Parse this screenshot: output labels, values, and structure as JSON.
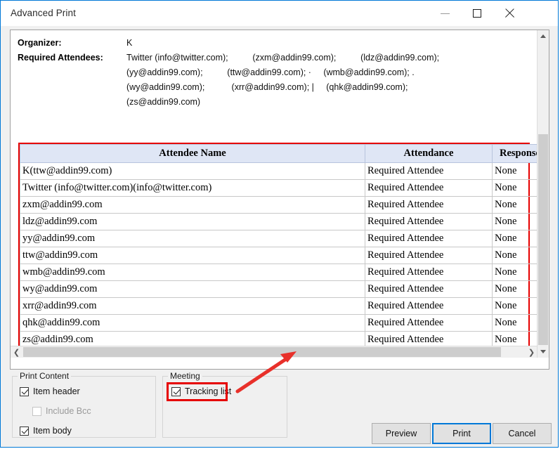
{
  "window": {
    "title": "Advanced Print",
    "controls": {
      "minimize": "minimize-icon",
      "maximize": "maximize-icon",
      "close": "close-icon"
    }
  },
  "preview": {
    "organizer_label": "Organizer:",
    "organizer_value": "K",
    "required_label": "Required Attendees:",
    "attendee_lines": [
      "Twitter (info@twitter.com);          (zxm@addin99.com);          (ldz@addin99.com);",
      "(yy@addin99.com);          (ttw@addin99.com); ·     (wmb@addin99.com); .",
      "(wy@addin99.com);           (xrr@addin99.com); |     (qhk@addin99.com);",
      "(zs@addin99.com)"
    ],
    "table": {
      "columns": [
        "Attendee Name",
        "Attendance",
        "Response"
      ],
      "rows": [
        [
          "K(ttw@addin99.com)",
          "Required Attendee",
          "None"
        ],
        [
          "Twitter (info@twitter.com)(info@twitter.com)",
          "Required Attendee",
          "None"
        ],
        [
          "zxm@addin99.com",
          "Required Attendee",
          "None"
        ],
        [
          "ldz@addin99.com",
          "Required Attendee",
          "None"
        ],
        [
          "yy@addin99.com",
          "Required Attendee",
          "None"
        ],
        [
          "ttw@addin99.com",
          "Required Attendee",
          "None"
        ],
        [
          "wmb@addin99.com",
          "Required Attendee",
          "None"
        ],
        [
          " wy@addin99.com",
          "Required Attendee",
          "None"
        ],
        [
          "xrr@addin99.com",
          "Required Attendee",
          "None"
        ],
        [
          "qhk@addin99.com",
          "Required Attendee",
          "None"
        ],
        [
          "zs@addin99.com",
          "Required Attendee",
          "None"
        ]
      ]
    }
  },
  "print_content": {
    "group_title": "Print Content",
    "item_header": {
      "label": "Item header",
      "checked": true,
      "enabled": true
    },
    "include_bcc": {
      "label": "Include Bcc",
      "checked": false,
      "enabled": false
    },
    "item_body": {
      "label": "Item body",
      "checked": true,
      "enabled": true
    }
  },
  "meeting": {
    "group_title": "Meeting",
    "tracking_list": {
      "label": "Tracking list",
      "checked": true,
      "enabled": true
    }
  },
  "buttons": {
    "preview": "Preview",
    "print": "Print",
    "cancel": "Cancel"
  },
  "colors": {
    "accent": "#0078d7",
    "highlight": "#e60000",
    "table_header_bg": "#dfe6f5",
    "dialog_bg": "#f0f0f0"
  }
}
